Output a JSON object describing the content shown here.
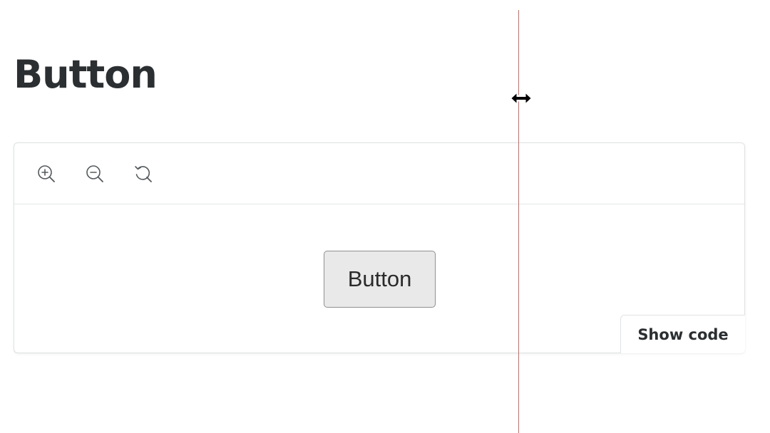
{
  "page": {
    "title": "Button"
  },
  "toolbar": {
    "zoom_in_icon": "zoom-in-icon",
    "zoom_out_icon": "zoom-out-icon",
    "reset_icon": "reset-zoom-icon"
  },
  "preview": {
    "demo_button_label": "Button",
    "show_code_label": "Show code"
  },
  "colors": {
    "title": "#2b2f31",
    "border": "#e0e2e3",
    "demo_button_bg": "#e9e9e9",
    "resize_line": "#b5726f"
  }
}
